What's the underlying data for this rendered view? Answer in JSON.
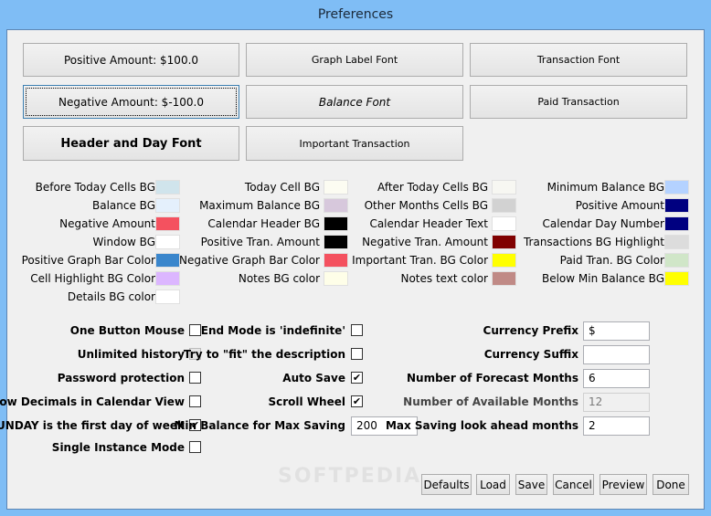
{
  "window": {
    "title": "Preferences"
  },
  "font_buttons": {
    "positive_amount": "Positive Amount: $100.0",
    "graph_label_font": "Graph Label Font",
    "transaction_font": "Transaction Font",
    "negative_amount": "Negative Amount: $-100.0",
    "balance_font": "Balance Font",
    "paid_transaction": "Paid Transaction",
    "header_day_font": "Header and Day Font",
    "important_transaction": "Important Transaction"
  },
  "colors": {
    "col1": [
      {
        "label": "Before Today Cells BG",
        "color": "#d0e4ec"
      },
      {
        "label": "Balance BG",
        "color": "#e4f0fc"
      },
      {
        "label": "Negative Amount",
        "color": "#f4515f"
      },
      {
        "label": "Window BG",
        "color": "#ffffff"
      },
      {
        "label": "Positive Graph Bar Color",
        "color": "#3a86cc"
      },
      {
        "label": "Cell Highlight BG Color",
        "color": "#dcb6ff"
      },
      {
        "label": "Details BG color",
        "color": "#ffffff"
      }
    ],
    "col2": [
      {
        "label": "Today Cell BG",
        "color": "#fcfcf2"
      },
      {
        "label": "Maximum Balance BG",
        "color": "#d7c8dc"
      },
      {
        "label": "Calendar Header BG",
        "color": "#000000"
      },
      {
        "label": "Positive Tran. Amount",
        "color": "#000000"
      },
      {
        "label": "Negative Graph Bar Color",
        "color": "#f4515f"
      },
      {
        "label": "Notes BG color",
        "color": "#fefee8"
      }
    ],
    "col3": [
      {
        "label": "After Today Cells BG",
        "color": "#f7f7f2"
      },
      {
        "label": "Other Months Cells BG",
        "color": "#d2d2d2"
      },
      {
        "label": "Calendar Header Text",
        "color": "#ffffff"
      },
      {
        "label": "Negative Tran. Amount",
        "color": "#800000"
      },
      {
        "label": "Important Tran. BG Color",
        "color": "#ffff00"
      },
      {
        "label": "Notes text color",
        "color": "#c08a86"
      }
    ],
    "col4": [
      {
        "label": "Minimum Balance BG",
        "color": "#b4d2ff"
      },
      {
        "label": "Positive Amount",
        "color": "#000080"
      },
      {
        "label": "Calendar Day Number",
        "color": "#000080"
      },
      {
        "label": "Transactions BG Highlight",
        "color": "#dcdcdc"
      },
      {
        "label": "Paid Tran. BG Color",
        "color": "#d0e6c8"
      },
      {
        "label": "Below Min Balance BG",
        "color": "#ffff00"
      }
    ]
  },
  "options": {
    "one_button_mouse": {
      "label": "One Button Mouse",
      "checked": false
    },
    "unlimited_history": {
      "label": "Unlimited history",
      "checked": false,
      "disabled": true
    },
    "password_protection": {
      "label": "Password protection",
      "checked": false
    },
    "show_decimals": {
      "label": "Show Decimals in Calendar View",
      "checked": false
    },
    "sunday_first": {
      "label": "SUNDAY is the first day of week",
      "checked": true
    },
    "single_instance": {
      "label": "Single Instance Mode",
      "checked": false
    },
    "end_mode_indefinite": {
      "label": "End Mode is 'indefinite'",
      "checked": false
    },
    "fit_description": {
      "label": "Try to \"fit\" the description",
      "checked": false
    },
    "auto_save": {
      "label": "Auto Save",
      "checked": true
    },
    "scroll_wheel": {
      "label": "Scroll Wheel",
      "checked": true
    },
    "min_balance_max_saving": {
      "label": "Min Balance for Max Saving",
      "value": "200"
    }
  },
  "fields": {
    "currency_prefix": {
      "label": "Currency Prefix",
      "value": "$"
    },
    "currency_suffix": {
      "label": "Currency Suffix",
      "value": ""
    },
    "forecast_months": {
      "label": "Number of Forecast Months",
      "value": "6"
    },
    "available_months": {
      "label": "Number of Available Months",
      "value": "12"
    },
    "max_saving_lookahead": {
      "label": "Max Saving look ahead months",
      "value": "2"
    }
  },
  "actions": {
    "defaults": "Defaults",
    "load": "Load",
    "save": "Save",
    "cancel": "Cancel",
    "preview": "Preview",
    "done": "Done"
  },
  "check_glyph": "✔",
  "watermark": "SOFTPEDIA"
}
